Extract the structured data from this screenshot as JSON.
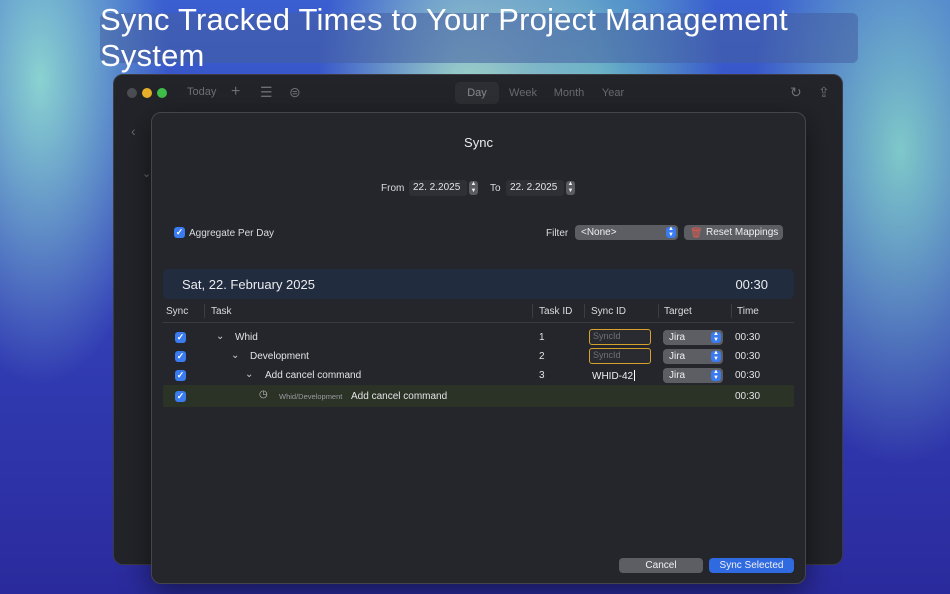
{
  "banner": {
    "title": "Sync Tracked Times to Your Project Management System"
  },
  "toolbar": {
    "today_label": "Today",
    "add_icon": "plus-icon",
    "list_icon": "list-icon",
    "filter_icon": "filter-circle-icon",
    "segments": [
      "Day",
      "Week",
      "Month",
      "Year"
    ],
    "active_segment": "Day",
    "history_icon": "history-icon",
    "share_icon": "share-icon"
  },
  "sync_dialog": {
    "title": "Sync",
    "from_label": "From",
    "from_value": "22.  2.2025",
    "to_label": "To",
    "to_value": "22.  2.2025",
    "aggregate_label": "Aggregate Per Day",
    "aggregate_checked": true,
    "filter_label": "Filter",
    "filter_value": "<None>",
    "reset_label": "Reset Mappings",
    "day_header": {
      "date": "Sat, 22. February 2025",
      "total": "00:30"
    },
    "columns": [
      "Sync",
      "Task",
      "Task ID",
      "Sync ID",
      "Target",
      "Time"
    ],
    "rows": [
      {
        "name": "Whid",
        "task_id": "1",
        "sync_id": "",
        "sync_placeholder": "SyncId",
        "target": "Jira",
        "time": "00:30"
      },
      {
        "name": "Development",
        "task_id": "2",
        "sync_id": "",
        "sync_placeholder": "SyncId",
        "target": "Jira",
        "time": "00:30"
      },
      {
        "name": "Add cancel command",
        "task_id": "3",
        "sync_id": "WHID-42",
        "target": "Jira",
        "time": "00:30"
      }
    ],
    "entry": {
      "path": "Whid/Development",
      "name": "Add cancel command",
      "time": "00:30"
    },
    "cancel_label": "Cancel",
    "sync_label": "Sync Selected"
  },
  "colors": {
    "accent": "#2f6ae0",
    "warning_outline": "#d7a22b",
    "trash": "#e45a4f"
  }
}
